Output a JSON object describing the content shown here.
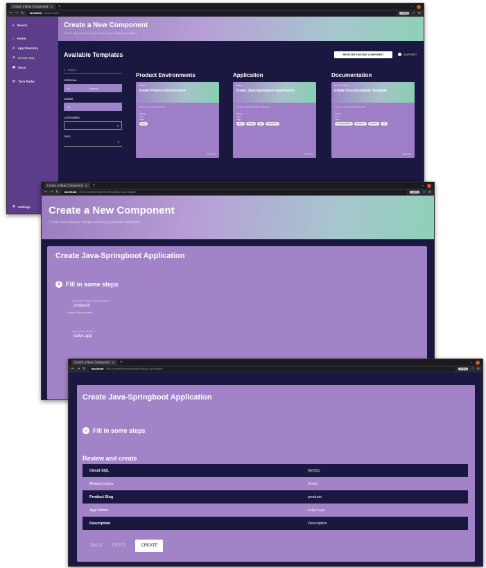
{
  "window1": {
    "tab_title": "Create a New Component",
    "url_host": "localhost",
    "url_path": ":3000/create",
    "zoom": "100%",
    "sidebar": {
      "items": [
        {
          "label": "Search",
          "icon": "search-icon"
        },
        {
          "label": "Home",
          "icon": "home-icon"
        },
        {
          "label": "App Directory",
          "icon": "directory-icon"
        },
        {
          "label": "Create App",
          "icon": "plus-circle-icon"
        },
        {
          "label": "Docs",
          "icon": "docs-icon"
        },
        {
          "label": "Tech Radar",
          "icon": "radar-icon"
        }
      ],
      "settings_label": "Settings"
    },
    "banner": {
      "title": "Create a New Component",
      "subtitle": "Create new software components using standard templates"
    },
    "templates_title": "Available Templates",
    "register_button": "REGISTER EXISTING COMPONENT",
    "support_label": "SUPPORT",
    "filters": {
      "search_placeholder": "Search",
      "personal_label": "PERSONAL",
      "personal_value": "Starred",
      "owner_label": "OWNER",
      "owner_value": "All",
      "categories_label": "CATEGORIES",
      "tags_label": "TAGS"
    },
    "columns": [
      {
        "heading": "Product Environments",
        "card": {
          "type": "Product",
          "title": "Create Product Environment",
          "desc": "Environment for the product",
          "owner_label": "Owner",
          "owner": "infra",
          "tags_label": "Tags",
          "tags": [
            "infra"
          ],
          "choose": "CHOOSE"
        }
      },
      {
        "heading": "Application",
        "card": {
          "type": "Service",
          "title": "Create Java-Springboot Application",
          "desc": "Create a Java Springboot Application",
          "owner_label": "Owner",
          "owner": "apps",
          "tags_label": "Tags",
          "tags": [
            "java",
            "spring",
            "api",
            "springboot"
          ],
          "choose": "CHOOSE"
        }
      },
      {
        "heading": "Documentation",
        "card": {
          "type": "Documentation",
          "title": "Create Documentation Template",
          "desc": "Create a new documentation site",
          "owner_label": "Owner",
          "owner": "docs",
          "tags_label": "Tags",
          "tags": [
            "documentation",
            "techdocs",
            "mkdocs",
            "md"
          ],
          "choose": "CHOOSE"
        }
      }
    ]
  },
  "window2": {
    "tab_title": "Create a New Component",
    "url_host": "localhost",
    "url_path": ":3000/create/templates/default/java-springboot",
    "zoom": "100%",
    "banner": {
      "title": "Create a New Component",
      "subtitle": "Create new software components using standard templates"
    },
    "form_title": "Create Java-Springboot Application",
    "step_number": "1",
    "step_label": "Fill in some steps",
    "fields": [
      {
        "label": "Choose Product Environment *",
        "value": "prodsurb",
        "helper": "Product Environment"
      },
      {
        "label": "Application Name *",
        "value": "kellys app",
        "helper": ""
      }
    ]
  },
  "window3": {
    "tab_title": "Create a New Component",
    "url_host": "localhost",
    "url_path": ":3000/create/templates/default/java-springboot",
    "zoom": "100%",
    "form_title": "Create Java-Springboot Application",
    "step_label": "Fill in some steps",
    "review_title": "Review and create",
    "review_rows": [
      {
        "key": "Cloud SQL",
        "value": "MySQL"
      },
      {
        "key": "Memorystore",
        "value": "Redis"
      },
      {
        "key": "Product Slug",
        "value": "produstr"
      },
      {
        "key": "App Name",
        "value": "kellys app"
      },
      {
        "key": "Description",
        "value": "Description"
      }
    ],
    "actions": {
      "back": "BACK",
      "reset": "RESET",
      "create": "CREATE"
    }
  }
}
